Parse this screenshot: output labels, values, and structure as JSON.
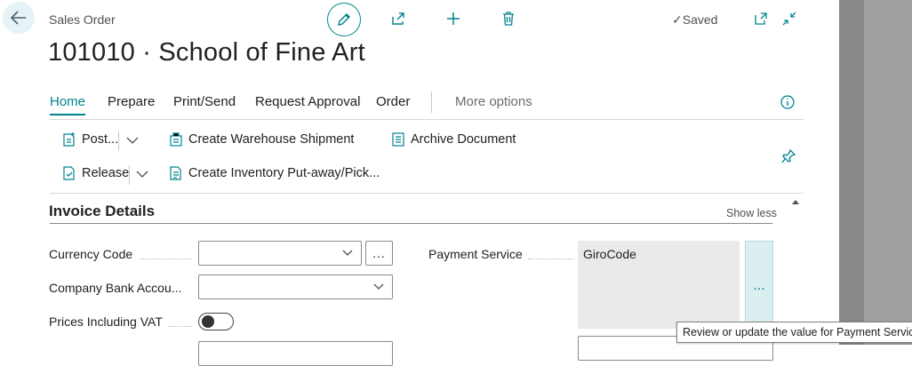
{
  "header": {
    "caption": "Sales Order",
    "title": "101010 · School of Fine Art",
    "status": "Saved"
  },
  "tabs": [
    {
      "label": "Home"
    },
    {
      "label": "Prepare"
    },
    {
      "label": "Print/Send"
    },
    {
      "label": "Request Approval"
    },
    {
      "label": "Order"
    },
    {
      "label": "More options"
    }
  ],
  "actions": {
    "post": "Post...",
    "create_warehouse_shipment": "Create Warehouse Shipment",
    "archive_document": "Archive Document",
    "release": "Release",
    "create_inventory": "Create Inventory Put-away/Pick..."
  },
  "section": {
    "title": "Invoice Details",
    "show_less": "Show less"
  },
  "fields": {
    "currency_code": {
      "label": "Currency Code",
      "value": ""
    },
    "company_bank_account": {
      "label": "Company Bank Accou...",
      "value": ""
    },
    "prices_including_vat": {
      "label": "Prices Including VAT",
      "value": false
    },
    "payment_service": {
      "label": "Payment Service",
      "value": "GiroCode"
    },
    "ellipsis": "..."
  },
  "tooltip": "Review or update the value for Payment Service",
  "colors": {
    "accent": "#00838f",
    "gutter": "#8a8886"
  }
}
